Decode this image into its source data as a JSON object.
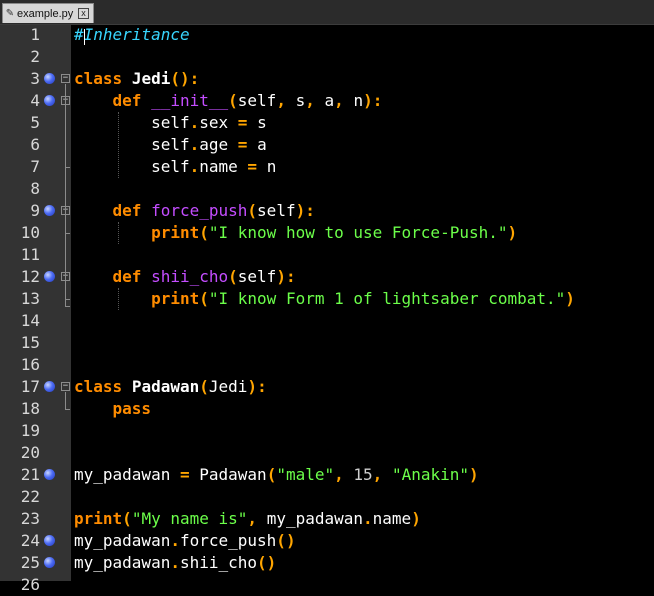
{
  "tab": {
    "filename": "example.py",
    "close_glyph": "x",
    "icon": "pencil-icon"
  },
  "lines": [
    {
      "n": "1",
      "code": "#Inheritance"
    },
    {
      "n": "2",
      "code": ""
    },
    {
      "n": "3",
      "code": "class Jedi():"
    },
    {
      "n": "4",
      "code": "    def __init__(self, s, a, n):"
    },
    {
      "n": "5",
      "code": "        self.sex = s"
    },
    {
      "n": "6",
      "code": "        self.age = a"
    },
    {
      "n": "7",
      "code": "        self.name = n"
    },
    {
      "n": "8",
      "code": ""
    },
    {
      "n": "9",
      "code": "    def force_push(self):"
    },
    {
      "n": "10",
      "code": "        print(\"I know how to use Force-Push.\")"
    },
    {
      "n": "11",
      "code": ""
    },
    {
      "n": "12",
      "code": "    def shii_cho(self):"
    },
    {
      "n": "13",
      "code": "        print(\"I know Form 1 of lightsaber combat.\")"
    },
    {
      "n": "14",
      "code": ""
    },
    {
      "n": "15",
      "code": ""
    },
    {
      "n": "16",
      "code": ""
    },
    {
      "n": "17",
      "code": "class Padawan(Jedi):"
    },
    {
      "n": "18",
      "code": "    pass"
    },
    {
      "n": "19",
      "code": ""
    },
    {
      "n": "20",
      "code": ""
    },
    {
      "n": "21",
      "code": "my_padawan = Padawan(\"male\", 15, \"Anakin\")"
    },
    {
      "n": "22",
      "code": ""
    },
    {
      "n": "23",
      "code": "print(\"My name is\", my_padawan.name)"
    },
    {
      "n": "24",
      "code": "my_padawan.force_push()"
    },
    {
      "n": "25",
      "code": "my_padawan.shii_cho()"
    },
    {
      "n": "26",
      "code": ""
    }
  ],
  "breakpoint_lines": [
    "3",
    "4",
    "9",
    "12",
    "17",
    "21",
    "24",
    "25"
  ],
  "fold_lines": [
    "3",
    "4",
    "9",
    "12",
    "17"
  ],
  "colors": {
    "background": "#000000",
    "gutter": "#333333",
    "keyword": "#ff8c00",
    "function": "#c44dff",
    "string": "#6cff4a",
    "comment": "#38d6ff",
    "breakpoint": "#4d6cf5"
  }
}
